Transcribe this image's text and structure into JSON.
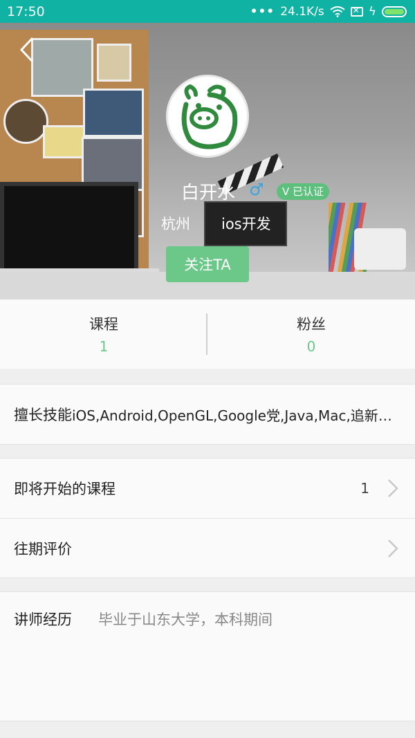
{
  "status_bar": {
    "time": "17:50",
    "network_speed": "24.1K/s",
    "icons": [
      "dots-icon",
      "wifi-icon",
      "sim-icon",
      "charging-bolt-icon",
      "battery-icon"
    ]
  },
  "profile": {
    "name": "白开水",
    "gender_icon": "♂",
    "verified": "V 已认证",
    "city": "杭州",
    "title": "ios开发",
    "follow_label": "关注TA"
  },
  "stats": [
    {
      "label": "课程",
      "value": "1"
    },
    {
      "label": "粉丝",
      "value": "0"
    }
  ],
  "skills": {
    "label": "擅长技能",
    "value": "iOS,Android,OpenGL,Google党,Java,Mac,追新族,Swift"
  },
  "menu": [
    {
      "label": "即将开始的课程",
      "count": "1"
    },
    {
      "label": "往期评价",
      "count": ""
    }
  ],
  "history": {
    "label": "讲师经历",
    "value": "毕业于山东大学，本科期间"
  },
  "colors": {
    "status_bar": "#10b3a3",
    "accent_green": "#6cc889",
    "gender_blue": "#3ba4e0"
  }
}
